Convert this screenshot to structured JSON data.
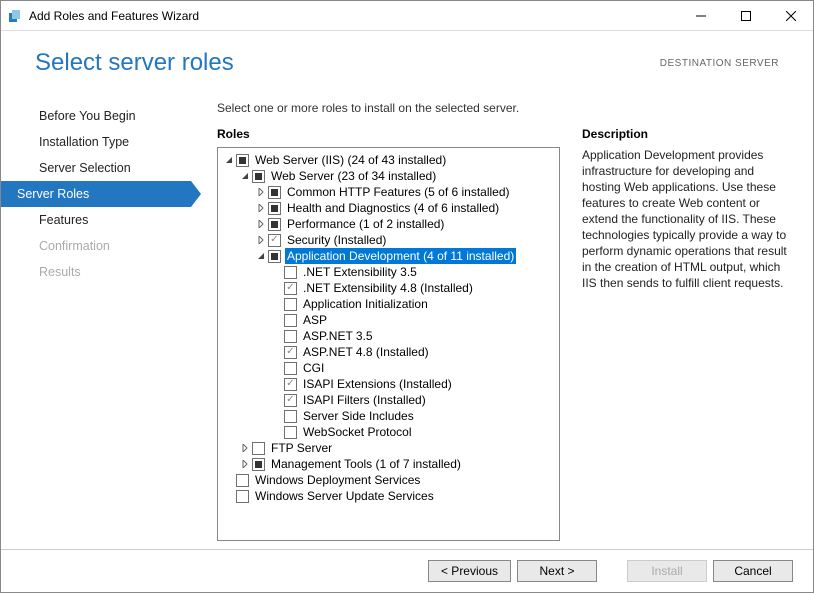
{
  "window": {
    "title": "Add Roles and Features Wizard"
  },
  "header": {
    "title": "Select server roles",
    "destination": "DESTINATION SERVER"
  },
  "nav": {
    "items": [
      {
        "label": "Before You Begin",
        "state": "normal"
      },
      {
        "label": "Installation Type",
        "state": "normal"
      },
      {
        "label": "Server Selection",
        "state": "normal"
      },
      {
        "label": "Server Roles",
        "state": "active"
      },
      {
        "label": "Features",
        "state": "normal"
      },
      {
        "label": "Confirmation",
        "state": "disabled"
      },
      {
        "label": "Results",
        "state": "disabled"
      }
    ]
  },
  "main": {
    "instruction": "Select one or more roles to install on the selected server.",
    "roles_title": "Roles",
    "desc_title": "Description",
    "desc_text": "Application Development provides infrastructure for developing and hosting Web applications. Use these features to create Web content or extend the functionality of IIS. These technologies typically provide a way to perform dynamic operations that result in the creation of HTML output, which IIS then sends to fulfill client requests.",
    "tree": [
      {
        "indent": 0,
        "arrow": "down",
        "check": "mixed",
        "label": "Web Server (IIS) (24 of 43 installed)",
        "selected": false
      },
      {
        "indent": 1,
        "arrow": "down",
        "check": "mixed",
        "label": "Web Server (23 of 34 installed)",
        "selected": false
      },
      {
        "indent": 2,
        "arrow": "right",
        "check": "mixed",
        "label": "Common HTTP Features (5 of 6 installed)",
        "selected": false
      },
      {
        "indent": 2,
        "arrow": "right",
        "check": "mixed",
        "label": "Health and Diagnostics (4 of 6 installed)",
        "selected": false
      },
      {
        "indent": 2,
        "arrow": "right",
        "check": "mixed",
        "label": "Performance (1 of 2 installed)",
        "selected": false
      },
      {
        "indent": 2,
        "arrow": "right",
        "check": "checked installed",
        "label": "Security (Installed)",
        "selected": false
      },
      {
        "indent": 2,
        "arrow": "down",
        "check": "mixed",
        "label": "Application Development (4 of 11 installed)",
        "selected": true
      },
      {
        "indent": 3,
        "arrow": "",
        "check": "",
        "label": ".NET Extensibility 3.5",
        "selected": false
      },
      {
        "indent": 3,
        "arrow": "",
        "check": "checked installed",
        "label": ".NET Extensibility 4.8 (Installed)",
        "selected": false
      },
      {
        "indent": 3,
        "arrow": "",
        "check": "",
        "label": "Application Initialization",
        "selected": false
      },
      {
        "indent": 3,
        "arrow": "",
        "check": "",
        "label": "ASP",
        "selected": false
      },
      {
        "indent": 3,
        "arrow": "",
        "check": "",
        "label": "ASP.NET 3.5",
        "selected": false
      },
      {
        "indent": 3,
        "arrow": "",
        "check": "checked installed",
        "label": "ASP.NET 4.8 (Installed)",
        "selected": false
      },
      {
        "indent": 3,
        "arrow": "",
        "check": "",
        "label": "CGI",
        "selected": false
      },
      {
        "indent": 3,
        "arrow": "",
        "check": "checked installed",
        "label": "ISAPI Extensions (Installed)",
        "selected": false
      },
      {
        "indent": 3,
        "arrow": "",
        "check": "checked installed",
        "label": "ISAPI Filters (Installed)",
        "selected": false
      },
      {
        "indent": 3,
        "arrow": "",
        "check": "",
        "label": "Server Side Includes",
        "selected": false
      },
      {
        "indent": 3,
        "arrow": "",
        "check": "",
        "label": "WebSocket Protocol",
        "selected": false
      },
      {
        "indent": 1,
        "arrow": "right",
        "check": "",
        "label": "FTP Server",
        "selected": false
      },
      {
        "indent": 1,
        "arrow": "right",
        "check": "mixed",
        "label": "Management Tools (1 of 7 installed)",
        "selected": false
      },
      {
        "indent": 0,
        "arrow": "",
        "check": "",
        "label": "Windows Deployment Services",
        "selected": false
      },
      {
        "indent": 0,
        "arrow": "",
        "check": "",
        "label": "Windows Server Update Services",
        "selected": false
      }
    ]
  },
  "footer": {
    "previous": "< Previous",
    "next": "Next >",
    "install": "Install",
    "cancel": "Cancel"
  }
}
